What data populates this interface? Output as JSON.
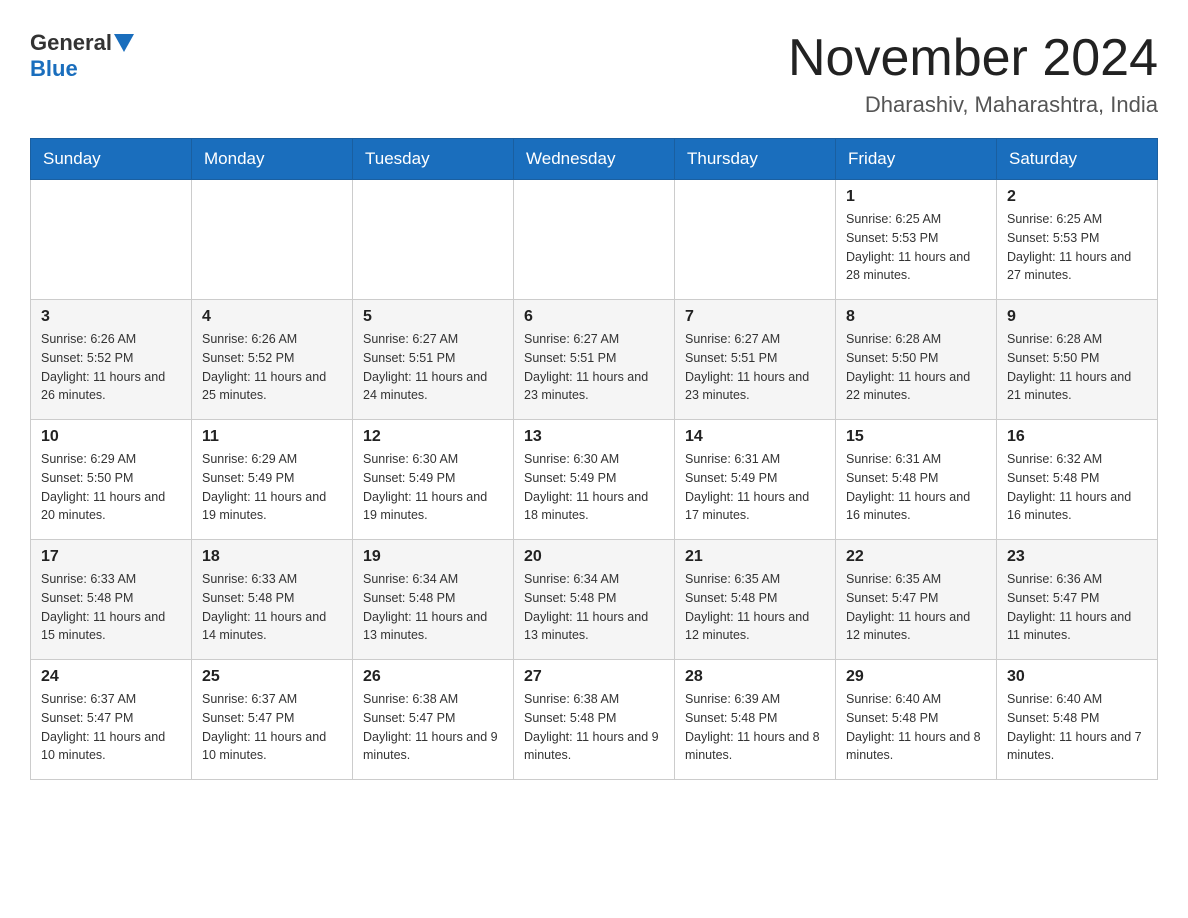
{
  "header": {
    "logo_general": "General",
    "logo_blue": "Blue",
    "month_year": "November 2024",
    "location": "Dharashiv, Maharashtra, India"
  },
  "weekdays": [
    "Sunday",
    "Monday",
    "Tuesday",
    "Wednesday",
    "Thursday",
    "Friday",
    "Saturday"
  ],
  "rows": [
    [
      {
        "day": "",
        "info": ""
      },
      {
        "day": "",
        "info": ""
      },
      {
        "day": "",
        "info": ""
      },
      {
        "day": "",
        "info": ""
      },
      {
        "day": "",
        "info": ""
      },
      {
        "day": "1",
        "info": "Sunrise: 6:25 AM\nSunset: 5:53 PM\nDaylight: 11 hours and 28 minutes."
      },
      {
        "day": "2",
        "info": "Sunrise: 6:25 AM\nSunset: 5:53 PM\nDaylight: 11 hours and 27 minutes."
      }
    ],
    [
      {
        "day": "3",
        "info": "Sunrise: 6:26 AM\nSunset: 5:52 PM\nDaylight: 11 hours and 26 minutes."
      },
      {
        "day": "4",
        "info": "Sunrise: 6:26 AM\nSunset: 5:52 PM\nDaylight: 11 hours and 25 minutes."
      },
      {
        "day": "5",
        "info": "Sunrise: 6:27 AM\nSunset: 5:51 PM\nDaylight: 11 hours and 24 minutes."
      },
      {
        "day": "6",
        "info": "Sunrise: 6:27 AM\nSunset: 5:51 PM\nDaylight: 11 hours and 23 minutes."
      },
      {
        "day": "7",
        "info": "Sunrise: 6:27 AM\nSunset: 5:51 PM\nDaylight: 11 hours and 23 minutes."
      },
      {
        "day": "8",
        "info": "Sunrise: 6:28 AM\nSunset: 5:50 PM\nDaylight: 11 hours and 22 minutes."
      },
      {
        "day": "9",
        "info": "Sunrise: 6:28 AM\nSunset: 5:50 PM\nDaylight: 11 hours and 21 minutes."
      }
    ],
    [
      {
        "day": "10",
        "info": "Sunrise: 6:29 AM\nSunset: 5:50 PM\nDaylight: 11 hours and 20 minutes."
      },
      {
        "day": "11",
        "info": "Sunrise: 6:29 AM\nSunset: 5:49 PM\nDaylight: 11 hours and 19 minutes."
      },
      {
        "day": "12",
        "info": "Sunrise: 6:30 AM\nSunset: 5:49 PM\nDaylight: 11 hours and 19 minutes."
      },
      {
        "day": "13",
        "info": "Sunrise: 6:30 AM\nSunset: 5:49 PM\nDaylight: 11 hours and 18 minutes."
      },
      {
        "day": "14",
        "info": "Sunrise: 6:31 AM\nSunset: 5:49 PM\nDaylight: 11 hours and 17 minutes."
      },
      {
        "day": "15",
        "info": "Sunrise: 6:31 AM\nSunset: 5:48 PM\nDaylight: 11 hours and 16 minutes."
      },
      {
        "day": "16",
        "info": "Sunrise: 6:32 AM\nSunset: 5:48 PM\nDaylight: 11 hours and 16 minutes."
      }
    ],
    [
      {
        "day": "17",
        "info": "Sunrise: 6:33 AM\nSunset: 5:48 PM\nDaylight: 11 hours and 15 minutes."
      },
      {
        "day": "18",
        "info": "Sunrise: 6:33 AM\nSunset: 5:48 PM\nDaylight: 11 hours and 14 minutes."
      },
      {
        "day": "19",
        "info": "Sunrise: 6:34 AM\nSunset: 5:48 PM\nDaylight: 11 hours and 13 minutes."
      },
      {
        "day": "20",
        "info": "Sunrise: 6:34 AM\nSunset: 5:48 PM\nDaylight: 11 hours and 13 minutes."
      },
      {
        "day": "21",
        "info": "Sunrise: 6:35 AM\nSunset: 5:48 PM\nDaylight: 11 hours and 12 minutes."
      },
      {
        "day": "22",
        "info": "Sunrise: 6:35 AM\nSunset: 5:47 PM\nDaylight: 11 hours and 12 minutes."
      },
      {
        "day": "23",
        "info": "Sunrise: 6:36 AM\nSunset: 5:47 PM\nDaylight: 11 hours and 11 minutes."
      }
    ],
    [
      {
        "day": "24",
        "info": "Sunrise: 6:37 AM\nSunset: 5:47 PM\nDaylight: 11 hours and 10 minutes."
      },
      {
        "day": "25",
        "info": "Sunrise: 6:37 AM\nSunset: 5:47 PM\nDaylight: 11 hours and 10 minutes."
      },
      {
        "day": "26",
        "info": "Sunrise: 6:38 AM\nSunset: 5:47 PM\nDaylight: 11 hours and 9 minutes."
      },
      {
        "day": "27",
        "info": "Sunrise: 6:38 AM\nSunset: 5:48 PM\nDaylight: 11 hours and 9 minutes."
      },
      {
        "day": "28",
        "info": "Sunrise: 6:39 AM\nSunset: 5:48 PM\nDaylight: 11 hours and 8 minutes."
      },
      {
        "day": "29",
        "info": "Sunrise: 6:40 AM\nSunset: 5:48 PM\nDaylight: 11 hours and 8 minutes."
      },
      {
        "day": "30",
        "info": "Sunrise: 6:40 AM\nSunset: 5:48 PM\nDaylight: 11 hours and 7 minutes."
      }
    ]
  ]
}
